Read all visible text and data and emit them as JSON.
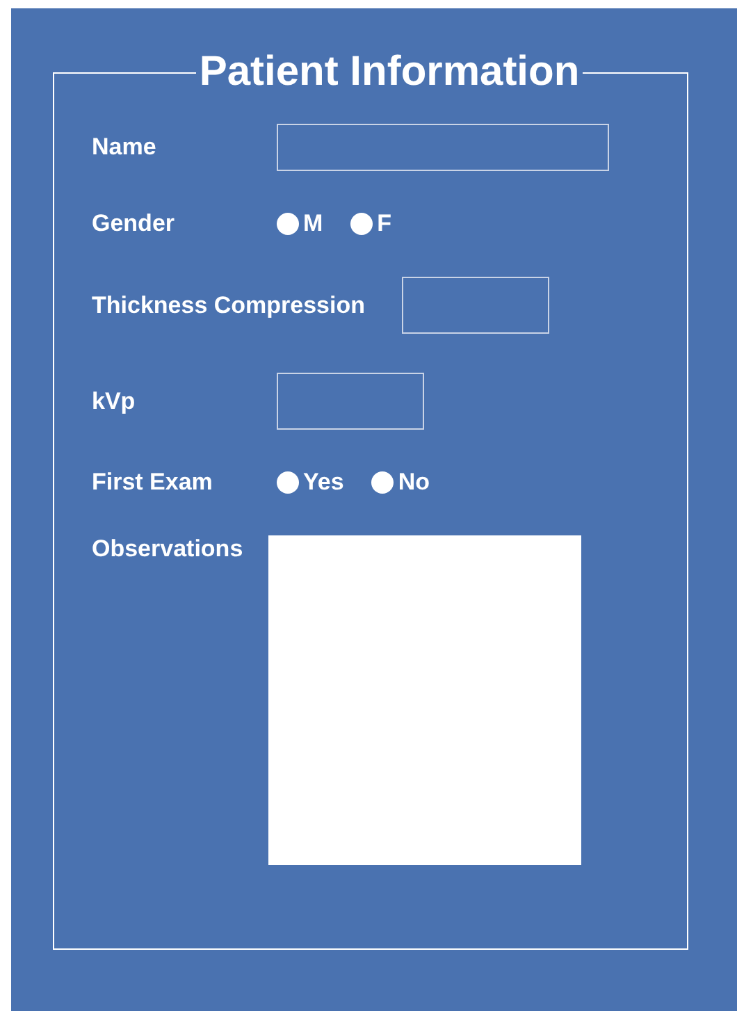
{
  "form": {
    "title": "Patient Information",
    "fields": [
      {
        "kind": "text",
        "label": "Name"
      },
      {
        "kind": "radio",
        "label": "Gender",
        "options": [
          {
            "label": "M",
            "selected": false
          },
          {
            "label": "F",
            "selected": false
          }
        ]
      },
      {
        "kind": "number",
        "label": "Thickness Compression"
      },
      {
        "kind": "number",
        "label": "kVp"
      },
      {
        "kind": "radio",
        "label": "First Exam",
        "options": [
          {
            "label": "Yes",
            "selected": false
          },
          {
            "label": "No",
            "selected": false
          }
        ]
      },
      {
        "kind": "textarea",
        "label": "Observations"
      }
    ]
  }
}
